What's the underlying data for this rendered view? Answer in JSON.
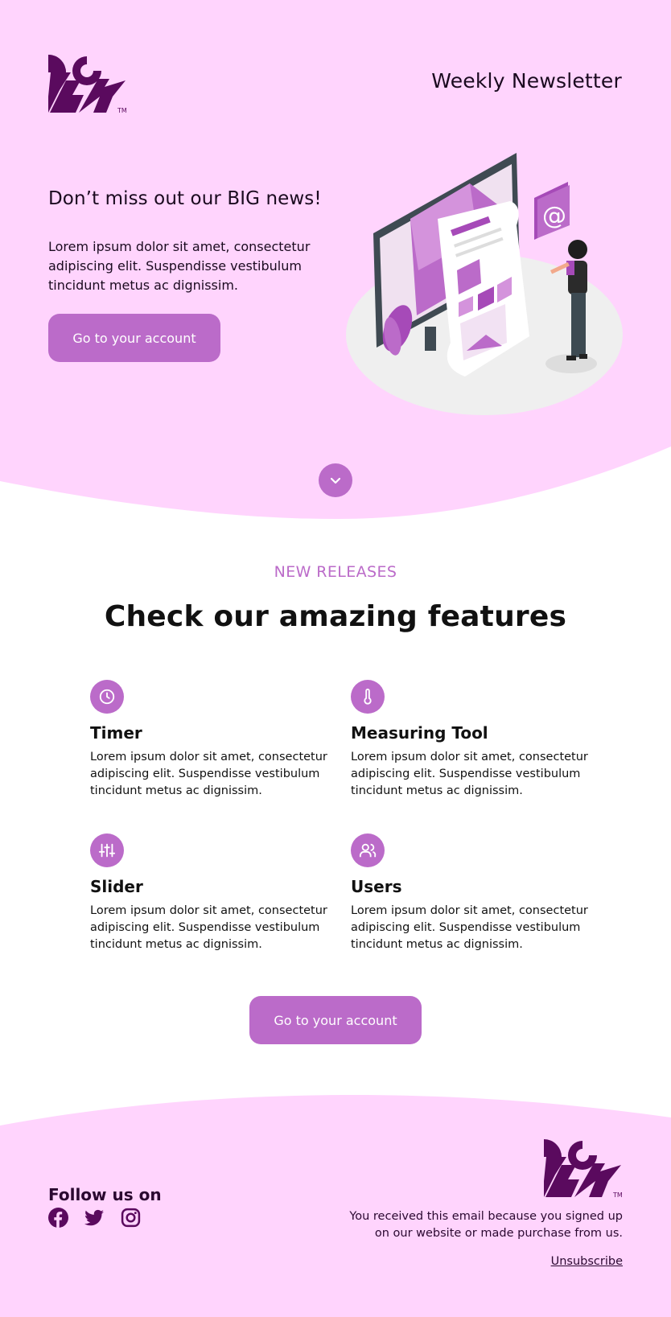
{
  "colors": {
    "hero_bg": "#ffd4fd",
    "accent": "#bb6bc9",
    "brand_dark": "#5a0a5e",
    "text": "#111111"
  },
  "header": {
    "logo_trademark": "TM",
    "title": "Weekly Newsletter"
  },
  "hero": {
    "heading": "Don’t miss out our BIG news!",
    "text": "Lorem ipsum dolor sit amet, consectetur adipiscing elit. Suspendisse vestibulum tincidunt metus ac dignissim.",
    "button_label": "Go to your account",
    "illustration": "newsletter-illustration",
    "scroll_icon": "chevron-down-icon"
  },
  "features": {
    "eyebrow": "NEW RELEASES",
    "heading": "Check our amazing features",
    "items": [
      {
        "icon": "clock-icon",
        "title": "Timer",
        "text": "Lorem ipsum dolor sit amet, consectetur adipiscing elit. Suspendisse vestibulum tincidunt metus ac dignissim."
      },
      {
        "icon": "thermometer-icon",
        "title": "Measuring Tool",
        "text": "Lorem ipsum dolor sit amet, consectetur adipiscing elit. Suspendisse vestibulum tincidunt metus ac dignissim."
      },
      {
        "icon": "sliders-icon",
        "title": "Slider",
        "text": "Lorem ipsum dolor sit amet, consectetur adipiscing elit. Suspendisse vestibulum tincidunt metus ac dignissim."
      },
      {
        "icon": "users-icon",
        "title": "Users",
        "text": "Lorem ipsum dolor sit amet, consectetur adipiscing elit. Suspendisse vestibulum tincidunt metus ac dignissim."
      }
    ],
    "button_label": "Go to your account"
  },
  "footer": {
    "follow_title": "Follow us on",
    "socials": [
      "facebook-icon",
      "twitter-icon",
      "instagram-icon"
    ],
    "logo_trademark": "TM",
    "note": "You received this email because you signed up on our website or made purchase from us.",
    "unsubscribe": "Unsubscribe"
  }
}
